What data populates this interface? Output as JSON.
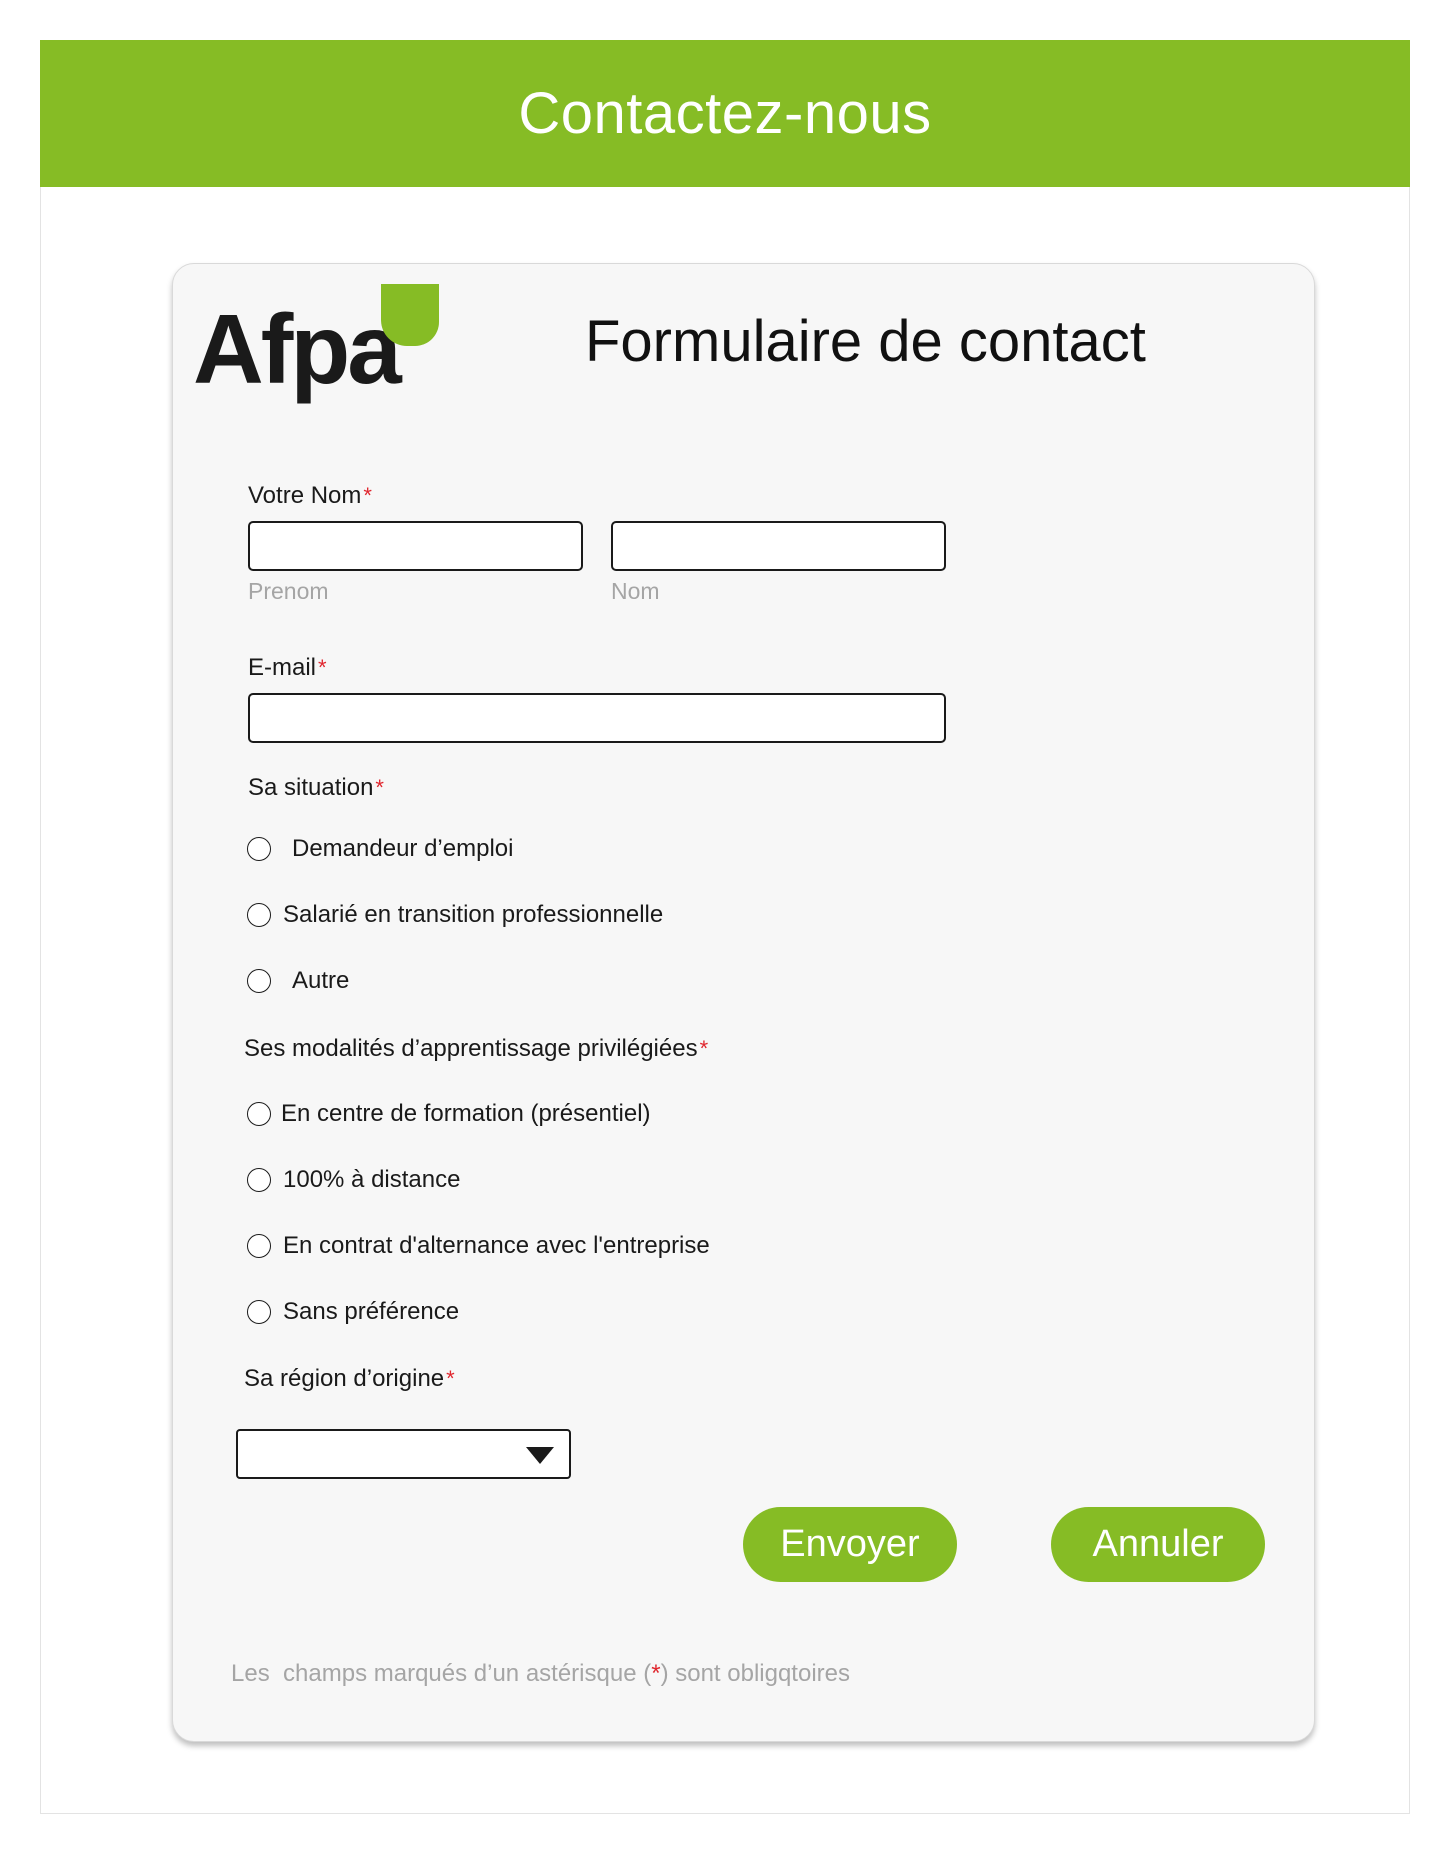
{
  "header": {
    "title": "Contactez-nous"
  },
  "logo": {
    "text": "Afpa"
  },
  "form": {
    "title": "Formulaire de contact",
    "name_label": "Votre Nom",
    "first_name_hint": "Prenom",
    "last_name_hint": "Nom",
    "email_label": "E-mail",
    "situation_label": "Sa situation",
    "situation_options": [
      "Demandeur d’emploi",
      "Salarié en transition professionnelle",
      "Autre"
    ],
    "learning_label": "Ses modalités d’apprentissage privilégiées",
    "learning_options": [
      "En centre de formation (présentiel)",
      "100% à distance",
      "En contrat d'alternance avec l'entreprise",
      "Sans préférence"
    ],
    "region_label": "Sa région d’origine",
    "required_mark": "*",
    "submit_label": "Envoyer",
    "cancel_label": "Annuler",
    "footer_note_before": "Les  champs marqués d’un astérisque (",
    "footer_note_after": ") sont obligqtoires"
  },
  "colors": {
    "brand_green": "#86bc25",
    "required_red": "#e0262e",
    "hint_gray": "#a5a5a5"
  },
  "icons": {
    "logo_leaf": "leaf-icon",
    "dropdown": "caret-down-icon"
  }
}
